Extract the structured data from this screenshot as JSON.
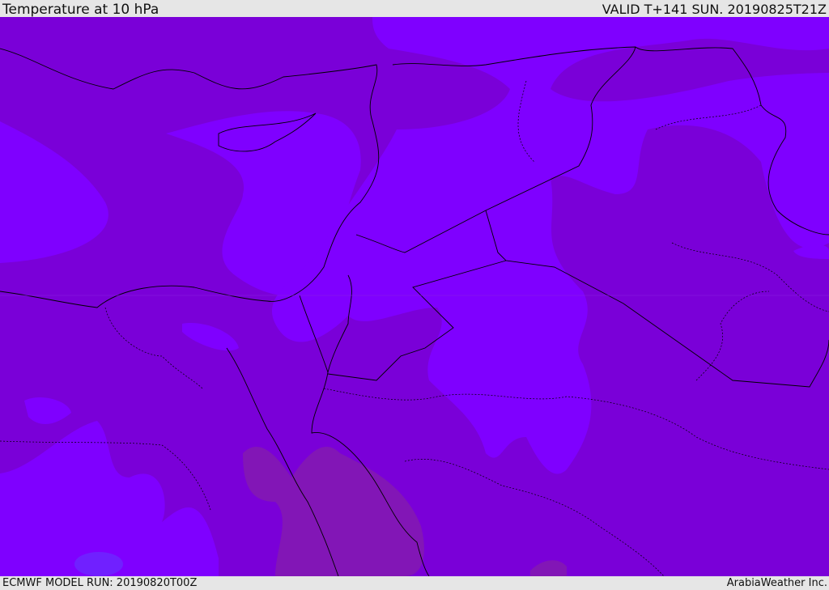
{
  "header": {
    "title": "Temperature at 10 hPa",
    "valid": "VALID T+141 SUN. 20190825T21Z"
  },
  "footer": {
    "model_run": "ECMWF MODEL RUN: 20190820T00Z",
    "credit": "ArabiaWeather Inc."
  },
  "colors": {
    "dark_band": "#7a00d8",
    "light_band": "#7f00ff",
    "warm_band": "#8216b6",
    "cool_spot": "#7020ff",
    "borders": "#000000"
  }
}
